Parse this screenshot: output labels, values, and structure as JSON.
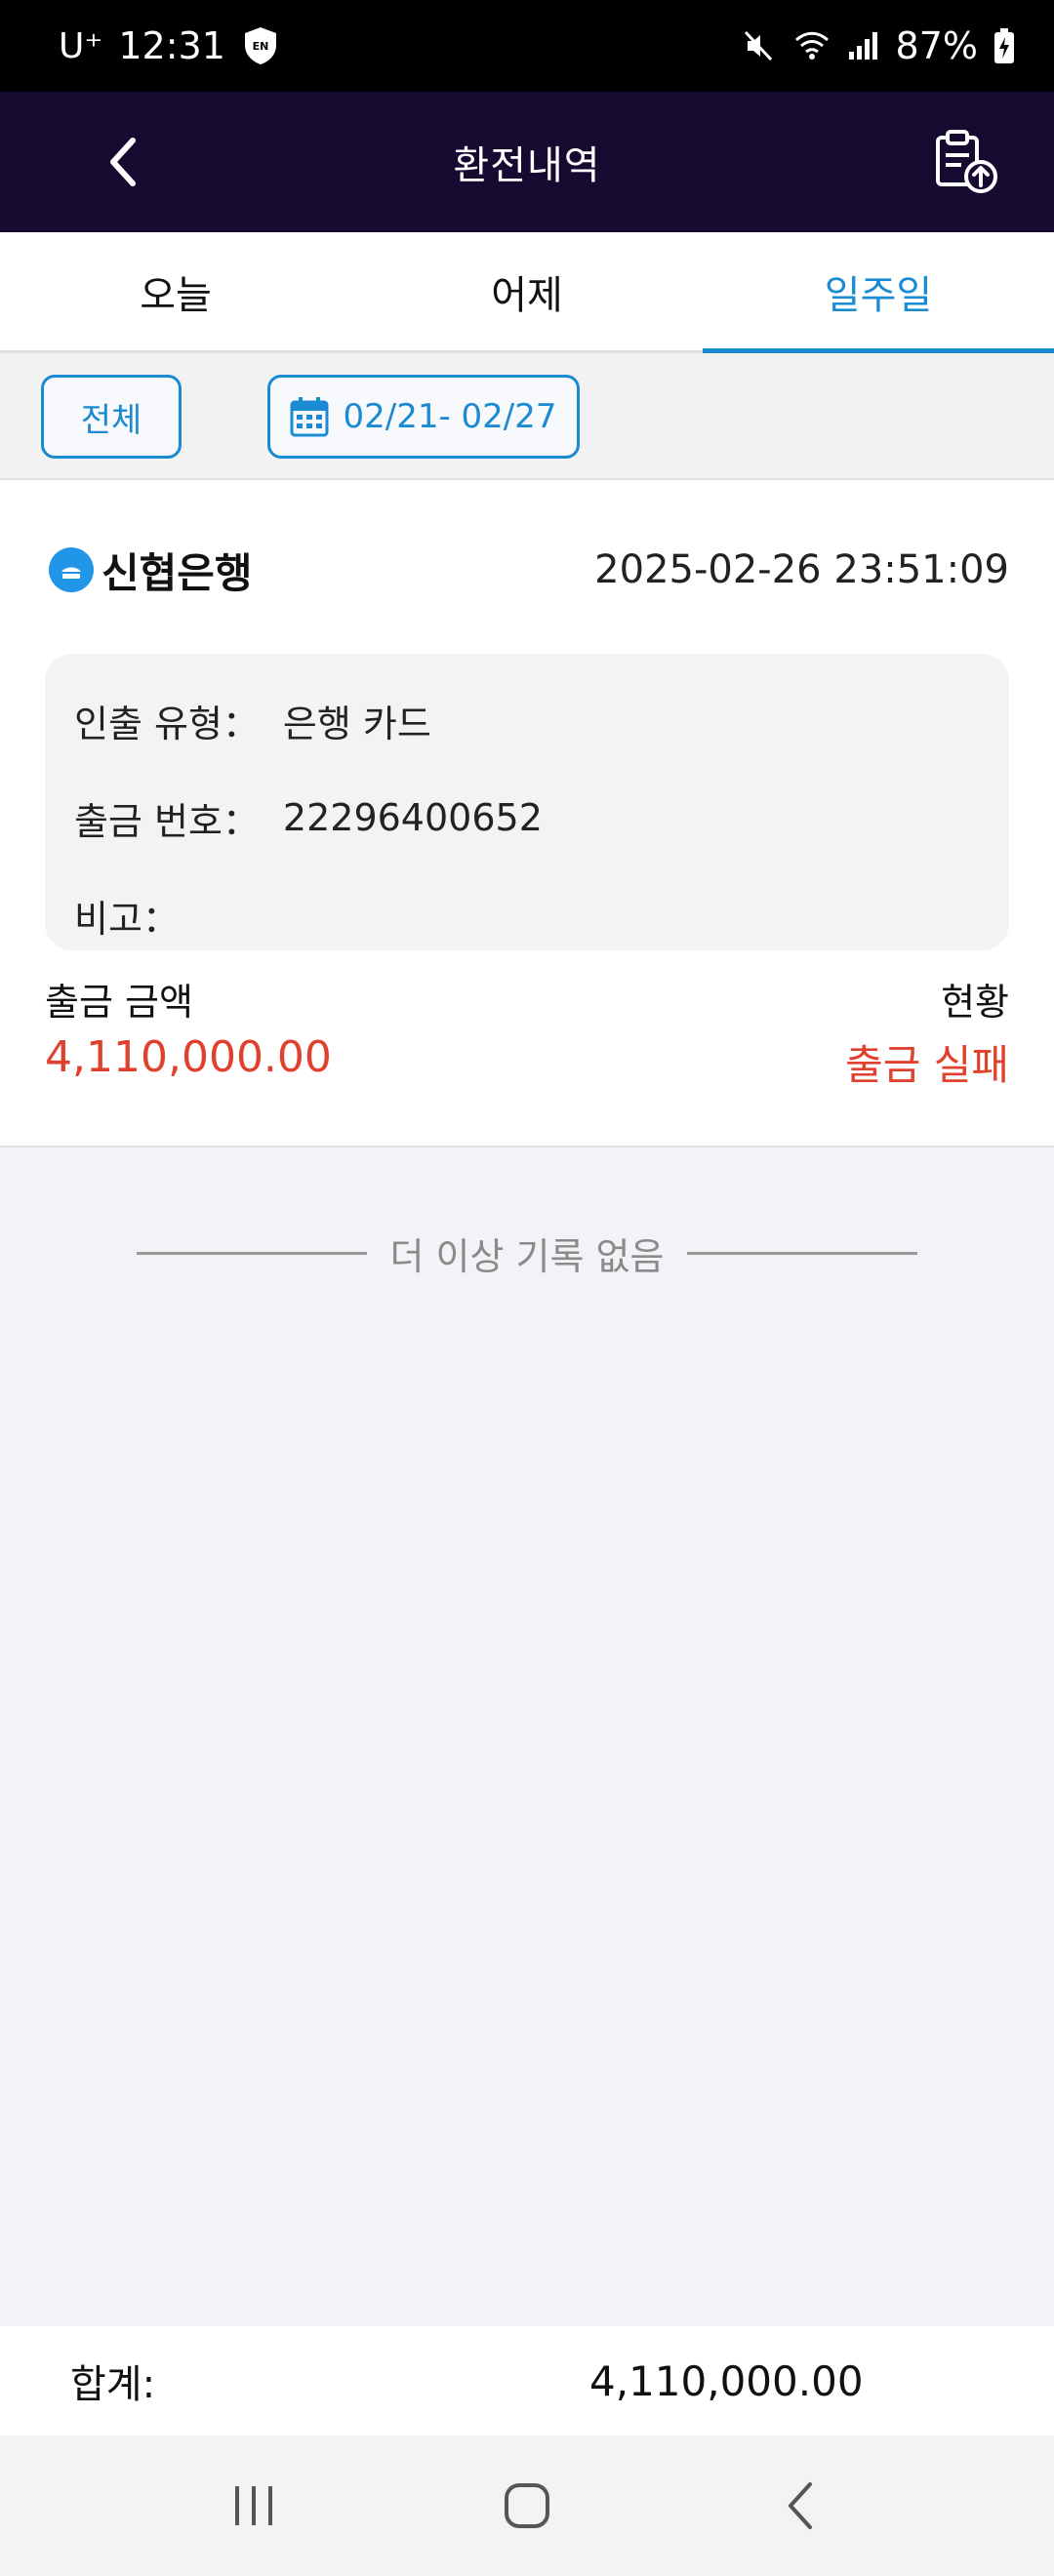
{
  "status_bar": {
    "carrier": "U⁺",
    "time": "12:31",
    "battery": "87%",
    "icons": [
      "shield-en-icon",
      "mute-icon",
      "wifi-icon",
      "signal-icon",
      "battery-charging-icon"
    ]
  },
  "app_bar": {
    "title": "환전내역",
    "back_icon": "chevron-left-icon",
    "export_icon": "clipboard-upload-icon"
  },
  "tabs": [
    {
      "label": "오늘",
      "active": false
    },
    {
      "label": "어제",
      "active": false
    },
    {
      "label": "일주일",
      "active": true
    }
  ],
  "filters": {
    "all_label": "전체",
    "date_range": "02/21- 02/27",
    "date_icon": "calendar-icon"
  },
  "record": {
    "bank_name": "신협은행",
    "datetime": "2025-02-26 23:51:09",
    "withdraw_type_label": "인출 유형：",
    "withdraw_type_value": "은행 카드",
    "withdraw_no_label": "출금 번호：",
    "withdraw_no_value": "22296400652",
    "note_label": "비고：",
    "note_value": "",
    "amount_label": "출금 금액",
    "amount_value": "4,110,000.00",
    "status_label": "현황",
    "status_value": "출금 실패"
  },
  "no_more_text": "더 이상 기록 없음",
  "total": {
    "label": "합계:",
    "value": "4,110,000.00"
  },
  "colors": {
    "app_bar": "#170a30",
    "accent": "#1a8ad2",
    "danger": "#e0412e"
  },
  "nav_bar": {
    "icons": [
      "recent-apps-icon",
      "home-icon",
      "back-icon"
    ]
  }
}
